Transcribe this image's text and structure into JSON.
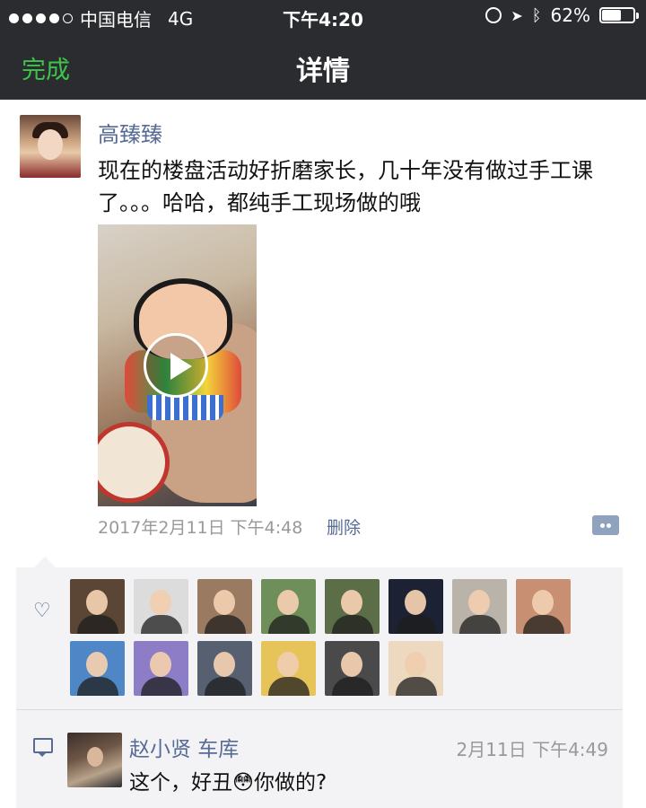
{
  "status_bar": {
    "carrier": "中国电信",
    "network": "4G",
    "time": "下午4:20",
    "battery_percent": "62%",
    "battery_level": 0.62
  },
  "nav": {
    "done_label": "完成",
    "title": "详情"
  },
  "post": {
    "author": "高臻臻",
    "text": "现在的楼盘活动好折磨家长，几十年没有做过手工课了。。。哈哈，都纯手工现场做的哦",
    "time": "2017年2月11日 下午4:48",
    "delete_label": "删除"
  },
  "likes": {
    "icon": "heart-outline-icon",
    "avatars": [
      {
        "bg": "#5b4636"
      },
      {
        "bg": "#dcdcdc"
      },
      {
        "bg": "#9a7b62"
      },
      {
        "bg": "#6f8f5a"
      },
      {
        "bg": "#5c6e47"
      },
      {
        "bg": "#1c2233"
      },
      {
        "bg": "#b9b3a9"
      },
      {
        "bg": "#c98f72"
      },
      {
        "bg": "#4f86c6"
      },
      {
        "bg": "#8d7cc6"
      },
      {
        "bg": "#566070"
      },
      {
        "bg": "#e6c45a"
      },
      {
        "bg": "#4a4a4a"
      },
      {
        "bg": "#ecd9c0"
      }
    ]
  },
  "comment": {
    "icon": "comment-icon",
    "name": "赵小贤 车库",
    "time": "2月11日 下午4:49",
    "text": "这个，好丑😳你做的?"
  },
  "colors": {
    "bar_bg": "#2b2c2f",
    "accent_green": "#3ec34b",
    "link_blue": "#576b95"
  }
}
